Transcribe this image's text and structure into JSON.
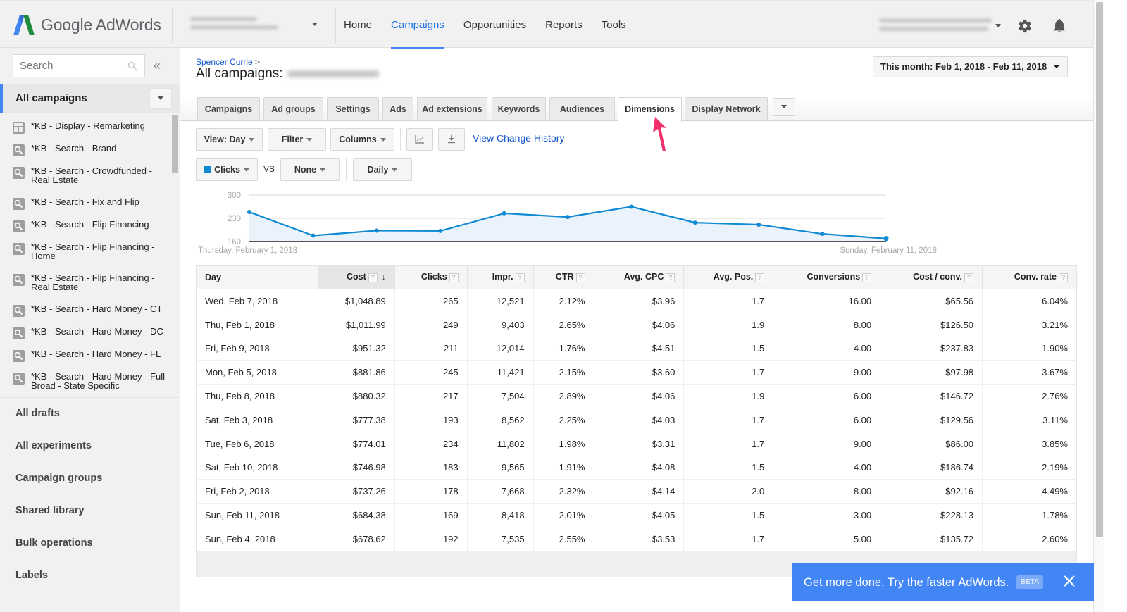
{
  "app": {
    "title": "Google AdWords"
  },
  "nav": {
    "items": [
      "Home",
      "Campaigns",
      "Opportunities",
      "Reports",
      "Tools"
    ],
    "active": "Campaigns"
  },
  "sidebar": {
    "search_placeholder": "Search",
    "collapse_glyph": "«",
    "all_campaigns_label": "All campaigns",
    "campaigns": [
      {
        "label": "*KB - Display - Remarketing",
        "type": "display"
      },
      {
        "label": "*KB - Search - Brand",
        "type": "search"
      },
      {
        "label": "*KB - Search - Crowdfunded - Real Estate",
        "type": "search"
      },
      {
        "label": "*KB - Search - Fix and Flip",
        "type": "search"
      },
      {
        "label": "*KB - Search - Flip Financing",
        "type": "search"
      },
      {
        "label": "*KB - Search - Flip Financing - Home",
        "type": "search"
      },
      {
        "label": "*KB - Search - Flip Financing - Real Estate",
        "type": "search"
      },
      {
        "label": "*KB - Search - Hard Money - CT",
        "type": "search"
      },
      {
        "label": "*KB - Search - Hard Money - DC",
        "type": "search"
      },
      {
        "label": "*KB - Search - Hard Money - FL",
        "type": "search"
      },
      {
        "label": "*KB - Search - Hard Money - Full Broad - State Specific",
        "type": "search"
      }
    ],
    "links": [
      "All drafts",
      "All experiments",
      "Campaign groups",
      "Shared library",
      "Bulk operations",
      "Labels"
    ]
  },
  "header": {
    "breadcrumb": "Spencer Currie",
    "breadcrumb_sep": ">",
    "page_title": "All campaigns:",
    "date_range": "This month: Feb 1, 2018 - Feb 11, 2018"
  },
  "tabs": {
    "items": [
      "Campaigns",
      "Ad groups",
      "Settings",
      "Ads",
      "Ad extensions",
      "Keywords",
      "Audiences",
      "Dimensions",
      "Display Network"
    ],
    "active": "Dimensions"
  },
  "toolbar": {
    "view": "View: Day",
    "filter": "Filter",
    "columns": "Columns",
    "view_change_history": "View Change History",
    "metric1": "Clicks",
    "vs": "VS",
    "metric2": "None",
    "granularity": "Daily"
  },
  "colors": {
    "accent": "#4285f4",
    "series": "#0f8ad3",
    "link": "#1155cc"
  },
  "chart_data": {
    "type": "line",
    "title": "",
    "series": [
      {
        "name": "Clicks",
        "values": [
          249,
          178,
          193,
          192,
          245,
          234,
          265,
          217,
          211,
          183,
          169
        ]
      }
    ],
    "x": [
      "Feb 1",
      "Feb 2",
      "Feb 3",
      "Feb 4",
      "Feb 5",
      "Feb 6",
      "Feb 7",
      "Feb 8",
      "Feb 9",
      "Feb 10",
      "Feb 11"
    ],
    "x_start_label": "Thursday, February 1, 2018",
    "x_end_label": "Sunday, February 11, 2018",
    "yticks": [
      "300",
      "230",
      "160"
    ],
    "ylim": [
      160,
      300
    ],
    "grid": true,
    "xlabel": "",
    "ylabel": ""
  },
  "table": {
    "columns": [
      "Day",
      "Cost",
      "Clicks",
      "Impr.",
      "CTR",
      "Avg. CPC",
      "Avg. Pos.",
      "Conversions",
      "Cost / conv.",
      "Conv. rate"
    ],
    "sorted_column": "Cost",
    "help_glyph": "?",
    "sort_glyph": "↓",
    "rows": [
      [
        "Wed, Feb 7, 2018",
        "$1,048.89",
        "265",
        "12,521",
        "2.12%",
        "$3.96",
        "1.7",
        "16.00",
        "$65.56",
        "6.04%"
      ],
      [
        "Thu, Feb 1, 2018",
        "$1,011.99",
        "249",
        "9,403",
        "2.65%",
        "$4.06",
        "1.9",
        "8.00",
        "$126.50",
        "3.21%"
      ],
      [
        "Fri, Feb 9, 2018",
        "$951.32",
        "211",
        "12,014",
        "1.76%",
        "$4.51",
        "1.5",
        "4.00",
        "$237.83",
        "1.90%"
      ],
      [
        "Mon, Feb 5, 2018",
        "$881.86",
        "245",
        "11,421",
        "2.15%",
        "$3.60",
        "1.7",
        "9.00",
        "$97.98",
        "3.67%"
      ],
      [
        "Thu, Feb 8, 2018",
        "$880.32",
        "217",
        "7,504",
        "2.89%",
        "$4.06",
        "1.9",
        "6.00",
        "$146.72",
        "2.76%"
      ],
      [
        "Sat, Feb 3, 2018",
        "$777.38",
        "193",
        "8,562",
        "2.25%",
        "$4.03",
        "1.7",
        "6.00",
        "$129.56",
        "3.11%"
      ],
      [
        "Tue, Feb 6, 2018",
        "$774.01",
        "234",
        "11,802",
        "1.98%",
        "$3.31",
        "1.7",
        "9.00",
        "$86.00",
        "3.85%"
      ],
      [
        "Sat, Feb 10, 2018",
        "$746.98",
        "183",
        "9,565",
        "1.91%",
        "$4.08",
        "1.5",
        "4.00",
        "$186.74",
        "2.19%"
      ],
      [
        "Fri, Feb 2, 2018",
        "$737.26",
        "178",
        "7,668",
        "2.32%",
        "$4.14",
        "2.0",
        "8.00",
        "$92.16",
        "4.49%"
      ],
      [
        "Sun, Feb 11, 2018",
        "$684.38",
        "169",
        "8,418",
        "2.01%",
        "$4.05",
        "1.5",
        "3.00",
        "$228.13",
        "1.78%"
      ],
      [
        "Sun, Feb 4, 2018",
        "$678.62",
        "192",
        "7,535",
        "2.55%",
        "$3.53",
        "1.7",
        "5.00",
        "$135.72",
        "2.60%"
      ]
    ]
  },
  "banner": {
    "text": "Get more done. Try the faster AdWords.",
    "badge": "BETA"
  }
}
